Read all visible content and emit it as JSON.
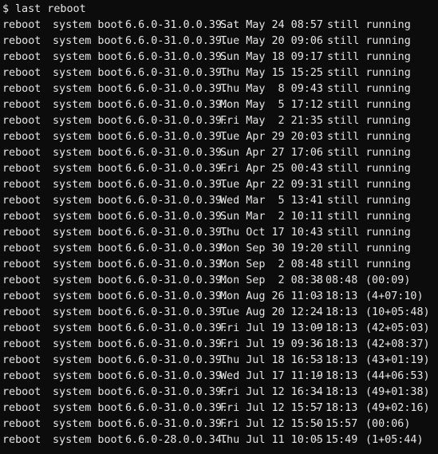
{
  "prompt": {
    "symbol": "$",
    "command": "last reboot"
  },
  "rows": [
    {
      "user": "reboot",
      "tty": "system boot",
      "kernel": "6.6.0-31.0.0.39.",
      "date": "Sat May 24 08:57",
      "sep": "",
      "until": "still running",
      "duration": ""
    },
    {
      "user": "reboot",
      "tty": "system boot",
      "kernel": "6.6.0-31.0.0.39.",
      "date": "Tue May 20 09:06",
      "sep": "",
      "until": "still running",
      "duration": ""
    },
    {
      "user": "reboot",
      "tty": "system boot",
      "kernel": "6.6.0-31.0.0.39.",
      "date": "Sun May 18 09:17",
      "sep": "",
      "until": "still running",
      "duration": ""
    },
    {
      "user": "reboot",
      "tty": "system boot",
      "kernel": "6.6.0-31.0.0.39.",
      "date": "Thu May 15 15:25",
      "sep": "",
      "until": "still running",
      "duration": ""
    },
    {
      "user": "reboot",
      "tty": "system boot",
      "kernel": "6.6.0-31.0.0.39.",
      "date": "Thu May  8 09:43",
      "sep": "",
      "until": "still running",
      "duration": ""
    },
    {
      "user": "reboot",
      "tty": "system boot",
      "kernel": "6.6.0-31.0.0.39.",
      "date": "Mon May  5 17:12",
      "sep": "",
      "until": "still running",
      "duration": ""
    },
    {
      "user": "reboot",
      "tty": "system boot",
      "kernel": "6.6.0-31.0.0.39.",
      "date": "Fri May  2 21:35",
      "sep": "",
      "until": "still running",
      "duration": ""
    },
    {
      "user": "reboot",
      "tty": "system boot",
      "kernel": "6.6.0-31.0.0.39.",
      "date": "Tue Apr 29 20:03",
      "sep": "",
      "until": "still running",
      "duration": ""
    },
    {
      "user": "reboot",
      "tty": "system boot",
      "kernel": "6.6.0-31.0.0.39.",
      "date": "Sun Apr 27 17:06",
      "sep": "",
      "until": "still running",
      "duration": ""
    },
    {
      "user": "reboot",
      "tty": "system boot",
      "kernel": "6.6.0-31.0.0.39.",
      "date": "Fri Apr 25 00:43",
      "sep": "",
      "until": "still running",
      "duration": ""
    },
    {
      "user": "reboot",
      "tty": "system boot",
      "kernel": "6.6.0-31.0.0.39.",
      "date": "Tue Apr 22 09:31",
      "sep": "",
      "until": "still running",
      "duration": ""
    },
    {
      "user": "reboot",
      "tty": "system boot",
      "kernel": "6.6.0-31.0.0.39.",
      "date": "Wed Mar  5 13:41",
      "sep": "",
      "until": "still running",
      "duration": ""
    },
    {
      "user": "reboot",
      "tty": "system boot",
      "kernel": "6.6.0-31.0.0.39.",
      "date": "Sun Mar  2 10:11",
      "sep": "",
      "until": "still running",
      "duration": ""
    },
    {
      "user": "reboot",
      "tty": "system boot",
      "kernel": "6.6.0-31.0.0.39.",
      "date": "Thu Oct 17 10:43",
      "sep": "",
      "until": "still running",
      "duration": ""
    },
    {
      "user": "reboot",
      "tty": "system boot",
      "kernel": "6.6.0-31.0.0.39.",
      "date": "Mon Sep 30 19:20",
      "sep": "",
      "until": "still running",
      "duration": ""
    },
    {
      "user": "reboot",
      "tty": "system boot",
      "kernel": "6.6.0-31.0.0.39.",
      "date": "Mon Sep  2 08:48",
      "sep": "",
      "until": "still running",
      "duration": ""
    },
    {
      "user": "reboot",
      "tty": "system boot",
      "kernel": "6.6.0-31.0.0.39.",
      "date": "Mon Sep  2 08:38",
      "sep": "-",
      "until": "08:48",
      "duration": "(00:09)"
    },
    {
      "user": "reboot",
      "tty": "system boot",
      "kernel": "6.6.0-31.0.0.39.",
      "date": "Mon Aug 26 11:03",
      "sep": "-",
      "until": "18:13",
      "duration": "(4+07:10)"
    },
    {
      "user": "reboot",
      "tty": "system boot",
      "kernel": "6.6.0-31.0.0.39.",
      "date": "Tue Aug 20 12:24",
      "sep": "-",
      "until": "18:13",
      "duration": "(10+05:48)"
    },
    {
      "user": "reboot",
      "tty": "system boot",
      "kernel": "6.6.0-31.0.0.39.",
      "date": "Fri Jul 19 13:09",
      "sep": "-",
      "until": "18:13",
      "duration": "(42+05:03)"
    },
    {
      "user": "reboot",
      "tty": "system boot",
      "kernel": "6.6.0-31.0.0.39.",
      "date": "Fri Jul 19 09:36",
      "sep": "-",
      "until": "18:13",
      "duration": "(42+08:37)"
    },
    {
      "user": "reboot",
      "tty": "system boot",
      "kernel": "6.6.0-31.0.0.39.",
      "date": "Thu Jul 18 16:53",
      "sep": "-",
      "until": "18:13",
      "duration": "(43+01:19)"
    },
    {
      "user": "reboot",
      "tty": "system boot",
      "kernel": "6.6.0-31.0.0.39.",
      "date": "Wed Jul 17 11:19",
      "sep": "-",
      "until": "18:13",
      "duration": "(44+06:53)"
    },
    {
      "user": "reboot",
      "tty": "system boot",
      "kernel": "6.6.0-31.0.0.39.",
      "date": "Fri Jul 12 16:34",
      "sep": "-",
      "until": "18:13",
      "duration": "(49+01:38)"
    },
    {
      "user": "reboot",
      "tty": "system boot",
      "kernel": "6.6.0-31.0.0.39.",
      "date": "Fri Jul 12 15:57",
      "sep": "-",
      "until": "18:13",
      "duration": "(49+02:16)"
    },
    {
      "user": "reboot",
      "tty": "system boot",
      "kernel": "6.6.0-31.0.0.39.",
      "date": "Fri Jul 12 15:50",
      "sep": "-",
      "until": "15:57",
      "duration": "(00:06)"
    },
    {
      "user": "reboot",
      "tty": "system boot",
      "kernel": "6.6.0-28.0.0.34.",
      "date": "Thu Jul 11 10:05",
      "sep": "-",
      "until": "15:49",
      "duration": "(1+05:44)"
    }
  ],
  "colors": {
    "background": "#0c0c0c",
    "foreground": "#e6e6e6"
  }
}
